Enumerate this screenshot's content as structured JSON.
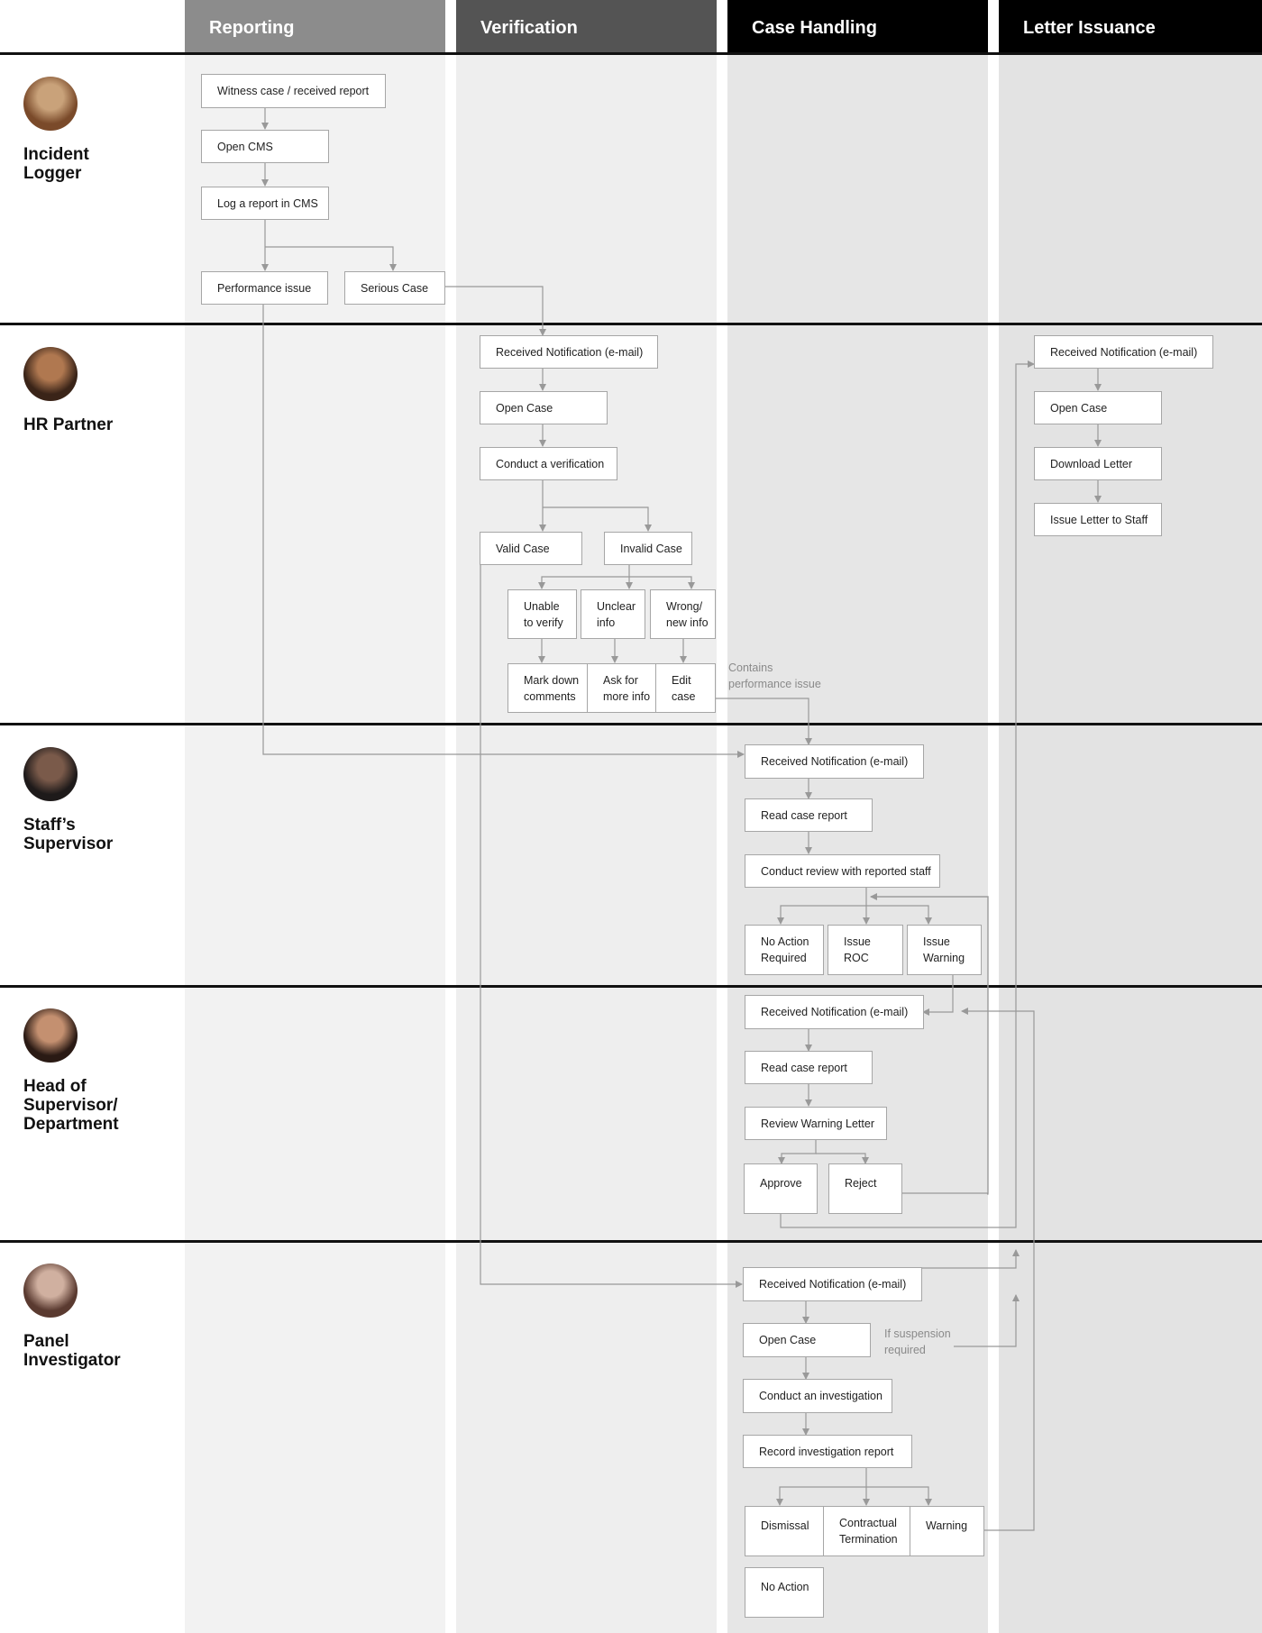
{
  "columns": [
    {
      "id": "reporting",
      "label": "Reporting",
      "header_color": "#8c8c8c",
      "bg_color": "#f2f2f2"
    },
    {
      "id": "verification",
      "label": "Verification",
      "header_color": "#545454",
      "bg_color": "#eeeeee"
    },
    {
      "id": "case_handling",
      "label": "Case Handling",
      "header_color": "#000000",
      "bg_color": "#e6e6e6"
    },
    {
      "id": "letter_issuance",
      "label": "Letter Issuance",
      "header_color": "#000000",
      "bg_color": "#e3e3e3"
    }
  ],
  "lanes": [
    {
      "id": "incident_logger",
      "label": "Incident Logger",
      "avatar_colors": [
        "#c9a27a",
        "#7a4a2a"
      ]
    },
    {
      "id": "hr_partner",
      "label": "HR Partner",
      "avatar_colors": [
        "#b07850",
        "#3a2418"
      ]
    },
    {
      "id": "staffs_supervisor",
      "label": "Staff’s Supervisor",
      "avatar_colors": [
        "#7a5a4a",
        "#1e1a1a"
      ]
    },
    {
      "id": "head_of_supervisor",
      "label": "Head of Supervisor/ Department",
      "avatar_colors": [
        "#c49070",
        "#2a1a14"
      ]
    },
    {
      "id": "panel_investigator",
      "label": "Panel Investigator",
      "avatar_colors": [
        "#d0b0a0",
        "#5a3a30"
      ]
    }
  ],
  "boxes": {
    "witness_case": "Witness case / received report",
    "open_cms": "Open CMS",
    "log_report": "Log a report in CMS",
    "performance_issue": "Performance issue",
    "serious_case": "Serious Case",
    "hr_received": "Received Notification (e-mail)",
    "hr_open_case": "Open Case",
    "conduct_verification": "Conduct a verification",
    "valid_case": "Valid Case",
    "invalid_case": "Invalid Case",
    "unable_verify": "Unable to verify",
    "unclear_info": "Unclear info",
    "wrong_info": "Wrong/ new info",
    "mark_down": "Mark down comments",
    "ask_more": "Ask for more info",
    "edit_case": "Edit case",
    "letter_received": "Received Notification (e-mail)",
    "letter_open_case": "Open Case",
    "download_letter": "Download Letter",
    "issue_letter": "Issue Letter to Staff",
    "sup_received": "Received Notification (e-mail)",
    "sup_read_report": "Read case report",
    "conduct_review": "Conduct review with reported staff",
    "no_action_required": "No Action Required",
    "issue_roc": "Issue ROC",
    "issue_warning": "Issue Warning",
    "head_received": "Received Notification (e-mail)",
    "head_read_report": "Read case report",
    "review_warning": "Review Warning Letter",
    "approve": "Approve",
    "reject": "Reject",
    "panel_received": "Received Notification (e-mail)",
    "panel_open_case": "Open Case",
    "conduct_investigation": "Conduct an investigation",
    "record_report": "Record investigation report",
    "dismissal": "Dismissal",
    "contractual_termination": "Contractual Termination",
    "warning": "Warning",
    "no_action": "No Action"
  },
  "notes": {
    "contains_performance": "Contains performance issue",
    "if_suspension": "If suspension required"
  },
  "colors": {
    "line": "#999999",
    "separator": "#111111",
    "box_border": "#a6a6a6"
  }
}
